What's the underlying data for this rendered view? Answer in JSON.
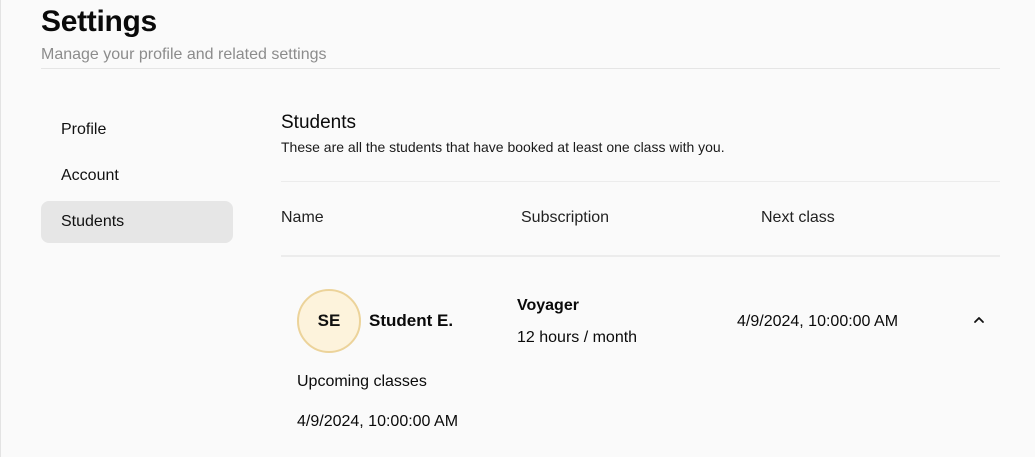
{
  "header": {
    "title": "Settings",
    "subtitle": "Manage your profile and related settings"
  },
  "sidebar": {
    "items": [
      {
        "label": "Profile",
        "active": false
      },
      {
        "label": "Account",
        "active": false
      },
      {
        "label": "Students",
        "active": true
      }
    ]
  },
  "students_section": {
    "title": "Students",
    "description": "These are all the students that have booked at least one class with you.",
    "columns": [
      "Name",
      "Subscription",
      "Next class"
    ],
    "rows": [
      {
        "initials": "SE",
        "name": "Student E.",
        "plan": "Voyager",
        "hours": "12 hours / month",
        "next_class": "4/9/2024, 10:00:00 AM",
        "expanded": true,
        "upcoming_title": "Upcoming classes",
        "upcoming": [
          "4/9/2024, 10:00:00 AM"
        ]
      }
    ]
  },
  "colors": {
    "background": "#fafafa",
    "avatar_fill": "#fdf3dc",
    "avatar_border": "#ecd39a",
    "active_item": "#e6e6e6",
    "muted_text": "#8c8c8c"
  },
  "icons": {
    "collapse": "chevron-up-icon"
  }
}
